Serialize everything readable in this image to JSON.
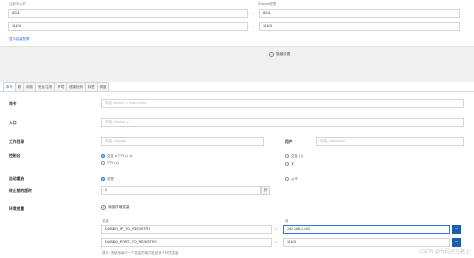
{
  "top": {
    "left_label": "注册中心的",
    "right_label": "Ruleset配置",
    "rows": [
      {
        "left": "8211",
        "right": "8211"
      },
      {
        "left": "11101",
        "right": "11101"
      }
    ],
    "link_text": "显示高级配置"
  },
  "collapse_label": "隐藏设置",
  "tabs": [
    "命令",
    "卷",
    "网络",
    "安全/主机",
    "环境",
    "健康检测",
    "标签",
    "调度"
  ],
  "form": {
    "command": {
      "label": "命令",
      "placeholder": "例如:/bin/sh -c 'echo hello'"
    },
    "entrypoint": {
      "label": "入口",
      "placeholder": "例如: /bin/sh -c"
    },
    "workdir": {
      "label": "工作目录",
      "placeholder": "例如: /myapp"
    },
    "user": {
      "label": "用户",
      "placeholder": "例如: username"
    },
    "console": {
      "label": "控制台",
      "options": [
        "交互 & TTY (-i -t)",
        "TTY (-t)",
        "交互 (-i)",
        "无"
      ],
      "selected": "交互 & TTY (-i -t)"
    },
    "restart": {
      "label": "自动重启",
      "options": [
        "总是",
        "从不"
      ],
      "selected": "总是"
    },
    "stop_timeout": {
      "label": "终止前的超时",
      "value": "0",
      "unit": "秒"
    },
    "env": {
      "label": "环境变量",
      "add_label": "添加环境变量",
      "col_var": "变量",
      "col_val": "值",
      "rows": [
        {
          "name": "DUBBO_IP_TO_REGISTRY",
          "value": "192.168.1.102"
        },
        {
          "name": "DUBBO_PORT_TO_REGISTRY",
          "value": "11101"
        }
      ],
      "hint": "提示: 请使用每行一个变量的格式粘贴多个环境变量"
    }
  },
  "watermark": "CSDN @代码还在路上",
  "colors": {
    "accent": "#2a7ae2",
    "remove_button": "#1a5fa8"
  }
}
